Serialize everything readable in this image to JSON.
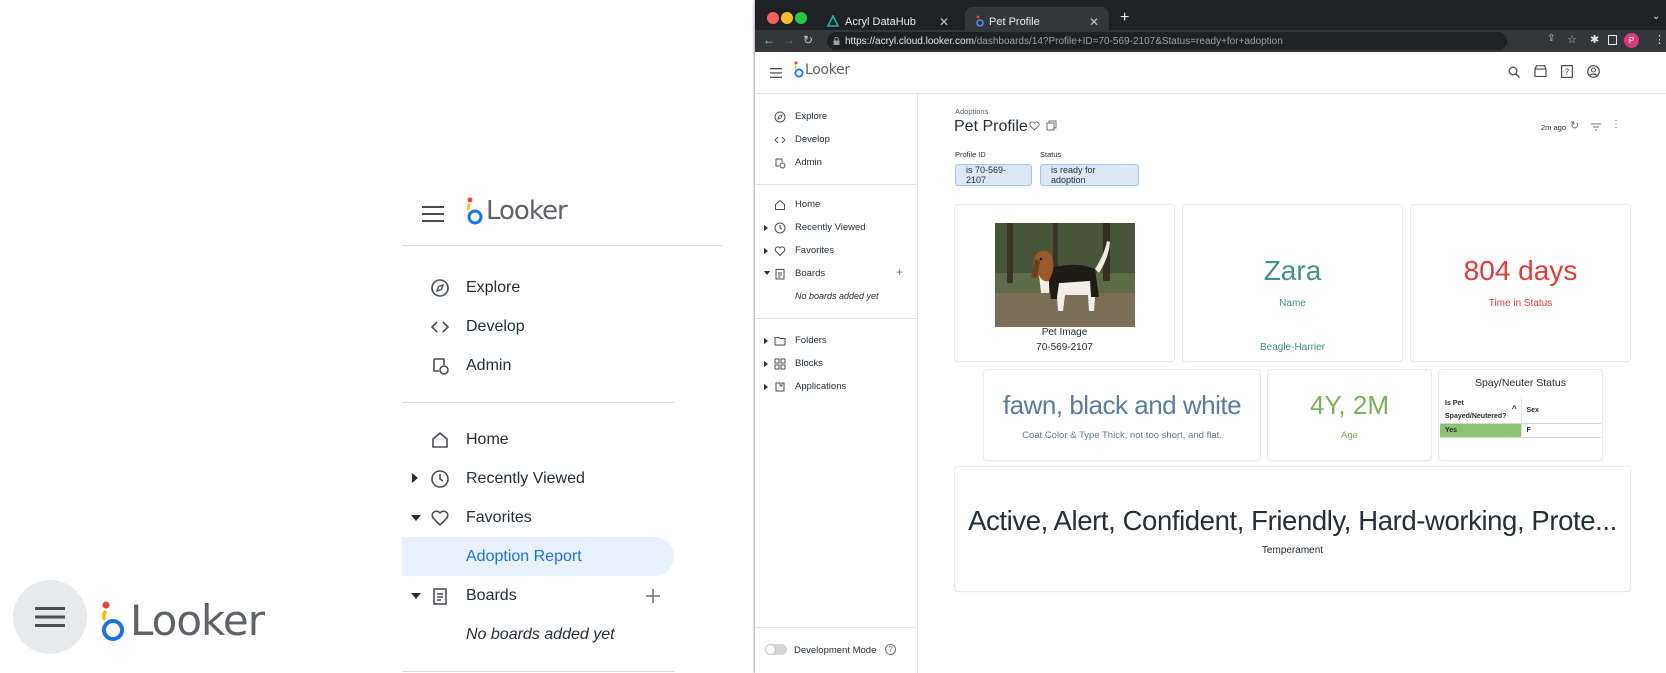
{
  "brand": {
    "logo_text": "Looker"
  },
  "colors": {
    "accent_blue": "#1a73e8",
    "selected_bg": "#e8f0fe",
    "name_teal": "#3f9189",
    "days_red": "#e03c3c",
    "age_green": "#7aaf5e",
    "coat_slate": "#5b7c9a",
    "yes_green": "#8cc16f"
  },
  "middle_panel": {
    "nav": [
      "Explore",
      "Develop",
      "Admin"
    ],
    "items": {
      "home": "Home",
      "recently_viewed": "Recently Viewed",
      "favorites": "Favorites",
      "adoption_report": "Adoption Report",
      "boards": "Boards",
      "no_boards": "No boards added yet"
    }
  },
  "browser": {
    "tabs": [
      {
        "label": "Acryl DataHub"
      },
      {
        "label": "Pet Profile"
      }
    ],
    "url_host": "https://acryl.cloud.looker.com",
    "url_path": "/dashboards/14?Profile+ID=70-569-2107&Status=ready+for+adoption",
    "avatar_letter": "P"
  },
  "sidebar": {
    "nav": [
      "Explore",
      "Develop",
      "Admin"
    ],
    "items": {
      "home": "Home",
      "recently_viewed": "Recently Viewed",
      "favorites": "Favorites",
      "boards": "Boards",
      "no_boards": "No boards added yet",
      "folders": "Folders",
      "blocks": "Blocks",
      "applications": "Applications"
    },
    "dev_mode": "Development Mode"
  },
  "dashboard": {
    "breadcrumb": "Adoptions",
    "title": "Pet Profile",
    "updated": "2m ago",
    "filters": [
      {
        "label": "Profile ID",
        "value": "is 70-569-2107"
      },
      {
        "label": "Status",
        "value": "is ready for adoption"
      }
    ],
    "tiles": {
      "image": {
        "caption": "Pet Image",
        "id": "70-569-2107"
      },
      "name": {
        "value": "Zara",
        "label": "Name",
        "breed": "Beagle-Harrier"
      },
      "time": {
        "value": "804 days",
        "label": "Time in Status"
      },
      "coat": {
        "value": "fawn, black and white",
        "label": "Coat Color & Type Thick, not too short, and flat."
      },
      "age": {
        "value": "4Y, 2M",
        "label": "Age"
      },
      "spay": {
        "title": "Spay/Neuter Status",
        "col1_line1": "Is Pet",
        "col1_line2": "Spayed/Neutered?",
        "col2": "Sex",
        "row_spayed": "Yes",
        "row_sex": "F"
      },
      "temperament": {
        "value": "Active, Alert, Confident, Friendly, Hard-working, Prote...",
        "label": "Temperament"
      }
    }
  }
}
